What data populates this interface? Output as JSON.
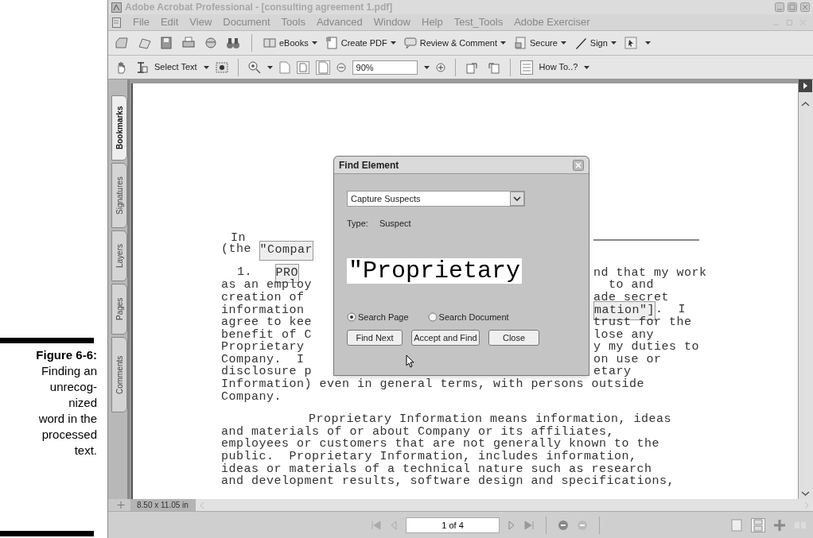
{
  "caption": {
    "label": "Figure 6-6:",
    "lines": [
      "Finding an",
      "unrecog-",
      "nized",
      "word in the",
      "processed",
      "text."
    ]
  },
  "window": {
    "title": "Adobe Acrobat Professional - [consulting agreement 1.pdf]"
  },
  "menu": [
    "File",
    "Edit",
    "View",
    "Document",
    "Tools",
    "Advanced",
    "Window",
    "Help",
    "Test_Tools",
    "Adobe Exerciser"
  ],
  "toolbar_1": [
    "eBooks",
    "Create PDF",
    "Review & Comment",
    "Secure",
    "Sign"
  ],
  "toolbar_2": {
    "select_tool": "Select Text",
    "zoom": "90%",
    "help": "How To..?"
  },
  "side_tabs": [
    {
      "label": "Bookmarks",
      "selected": true
    },
    {
      "label": "Signatures",
      "selected": false
    },
    {
      "label": "Layers",
      "selected": false
    },
    {
      "label": "Pages",
      "selected": false
    },
    {
      "label": "Comments",
      "selected": false
    }
  ],
  "document": {
    "lines": [
      {
        "kind": "heading",
        "left": [
          {
            "text": "In",
            "boxed": false
          }
        ],
        "rule": true
      },
      {
        "kind": "line",
        "left": [
          {
            "text": "(the ",
            "boxed": false
          },
          {
            "text": "\"Compar",
            "boxed": true
          }
        ]
      },
      {
        "kind": "numbered",
        "left": [
          {
            "text": "1.   ",
            "boxed": false
          },
          {
            "text": "PRO",
            "boxed": true
          }
        ],
        "right": [
          {
            "text": "nd that my work",
            "boxed": false
          }
        ]
      },
      {
        "kind": "line",
        "left": [
          {
            "text": "as an employ",
            "boxed": false
          }
        ],
        "right": [
          {
            "text": "  to and",
            "boxed": false
          }
        ]
      },
      {
        "kind": "line",
        "left": [
          {
            "text": "creation of",
            "boxed": false
          }
        ],
        "right": [
          {
            "text": "ade secret",
            "boxed": false
          }
        ]
      },
      {
        "kind": "line",
        "left": [
          {
            "text": "information",
            "boxed": false
          }
        ],
        "right": [
          {
            "text": "mation\"]",
            "boxed": true
          },
          {
            "text": ".  I",
            "boxed": false
          }
        ]
      },
      {
        "kind": "line",
        "left": [
          {
            "text": "agree to kee",
            "boxed": false
          }
        ],
        "right": [
          {
            "text": "trust for the",
            "boxed": false
          }
        ]
      },
      {
        "kind": "line",
        "left": [
          {
            "text": "benefit of C",
            "boxed": false
          }
        ],
        "right": [
          {
            "text": "lose any",
            "boxed": false
          }
        ]
      },
      {
        "kind": "line",
        "left": [
          {
            "text": "Proprietary",
            "boxed": false
          }
        ],
        "right": [
          {
            "text": "y my duties to",
            "boxed": false
          }
        ]
      },
      {
        "kind": "line",
        "left": [
          {
            "text": "Company.  I",
            "boxed": false
          }
        ],
        "right": [
          {
            "text": "on use or",
            "boxed": false
          }
        ]
      },
      {
        "kind": "line",
        "left": [
          {
            "text": "disclosure p",
            "boxed": false
          }
        ],
        "right": [
          {
            "text": "etary",
            "boxed": false
          }
        ]
      },
      {
        "kind": "line",
        "left": [
          {
            "text": "Information) even in general terms, with persons outside",
            "boxed": false
          }
        ]
      },
      {
        "kind": "line",
        "left": [
          {
            "text": "Company.",
            "boxed": false
          }
        ]
      },
      {
        "kind": "para",
        "left": [
          {
            "text": "Proprietary Information means information, ideas",
            "boxed": false
          }
        ]
      },
      {
        "kind": "line",
        "left": [
          {
            "text": "and materials of or about Company or its affiliates,",
            "boxed": false
          }
        ]
      },
      {
        "kind": "line",
        "left": [
          {
            "text": "employees or customers that are not generally known to the",
            "boxed": false
          }
        ]
      },
      {
        "kind": "line",
        "left": [
          {
            "text": "public.  Proprietary Information, includes information,",
            "boxed": false
          }
        ]
      },
      {
        "kind": "line",
        "left": [
          {
            "text": "ideas or materials of a technical nature such as research",
            "boxed": false
          }
        ]
      },
      {
        "kind": "line",
        "left": [
          {
            "text": "and development results, software design and specifications,",
            "boxed": false
          }
        ]
      }
    ]
  },
  "dialog": {
    "title": "Find Element",
    "dropdown": "Capture Suspects",
    "type_label": "Type:",
    "type_value": "Suspect",
    "suspect_text": "\"Proprietary",
    "scope": [
      {
        "label": "Search Page",
        "selected": true
      },
      {
        "label": "Search Document",
        "selected": false
      }
    ],
    "buttons": [
      "Find Next",
      "Accept and Find",
      "Close"
    ]
  },
  "page_size": "8.50 x 11.05 in",
  "status_bar": {
    "page": "1 of 4"
  }
}
